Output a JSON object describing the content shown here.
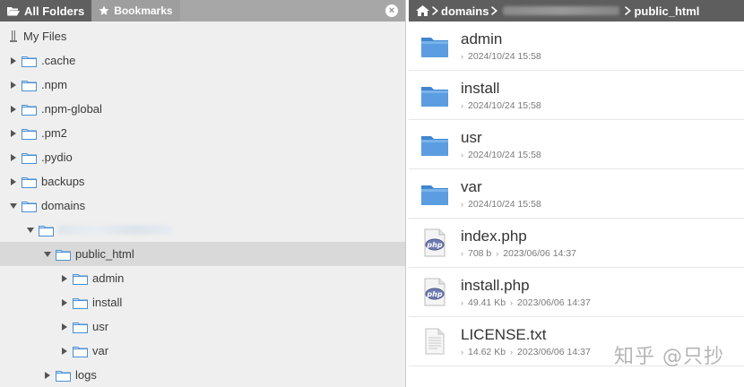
{
  "left_tabs": {
    "all_folders": "All Folders",
    "bookmarks": "Bookmarks",
    "close": "×"
  },
  "tree": {
    "root": "My Files",
    "items": [
      {
        "label": ".cache",
        "expanded": false,
        "level": 1
      },
      {
        "label": ".npm",
        "expanded": false,
        "level": 1
      },
      {
        "label": ".npm-global",
        "expanded": false,
        "level": 1
      },
      {
        "label": ".pm2",
        "expanded": false,
        "level": 1
      },
      {
        "label": ".pydio",
        "expanded": false,
        "level": 1
      },
      {
        "label": "backups",
        "expanded": false,
        "level": 1
      },
      {
        "label": "domains",
        "expanded": true,
        "level": 1
      },
      {
        "label": "",
        "expanded": true,
        "level": 2,
        "obscured": true
      },
      {
        "label": "public_html",
        "expanded": true,
        "level": 3,
        "selected": true
      },
      {
        "label": "admin",
        "expanded": false,
        "level": 4
      },
      {
        "label": "install",
        "expanded": false,
        "level": 4
      },
      {
        "label": "usr",
        "expanded": false,
        "level": 4
      },
      {
        "label": "var",
        "expanded": false,
        "level": 4
      },
      {
        "label": "logs",
        "expanded": false,
        "level": 3
      }
    ]
  },
  "breadcrumb": {
    "first": "domains",
    "last": "public_html"
  },
  "files": [
    {
      "name": "admin",
      "type": "folder",
      "size": "",
      "date": "2024/10/24 15:58"
    },
    {
      "name": "install",
      "type": "folder",
      "size": "",
      "date": "2024/10/24 15:58"
    },
    {
      "name": "usr",
      "type": "folder",
      "size": "",
      "date": "2024/10/24 15:58"
    },
    {
      "name": "var",
      "type": "folder",
      "size": "",
      "date": "2024/10/24 15:58"
    },
    {
      "name": "index.php",
      "type": "php",
      "size": "708 b",
      "date": "2023/06/06 14:37"
    },
    {
      "name": "install.php",
      "type": "php",
      "size": "49.41 Kb",
      "date": "2023/06/06 14:37"
    },
    {
      "name": "LICENSE.txt",
      "type": "txt",
      "size": "14.62 Kb",
      "date": "2023/06/06 14:37"
    }
  ],
  "watermark": "知乎 @只抄",
  "colors": {
    "folder_blue": "#4a8fd4",
    "tab_active": "#5f5f5f",
    "breadcrumb_bg": "#5e5e5e",
    "selected_row": "#d9d9d9"
  }
}
